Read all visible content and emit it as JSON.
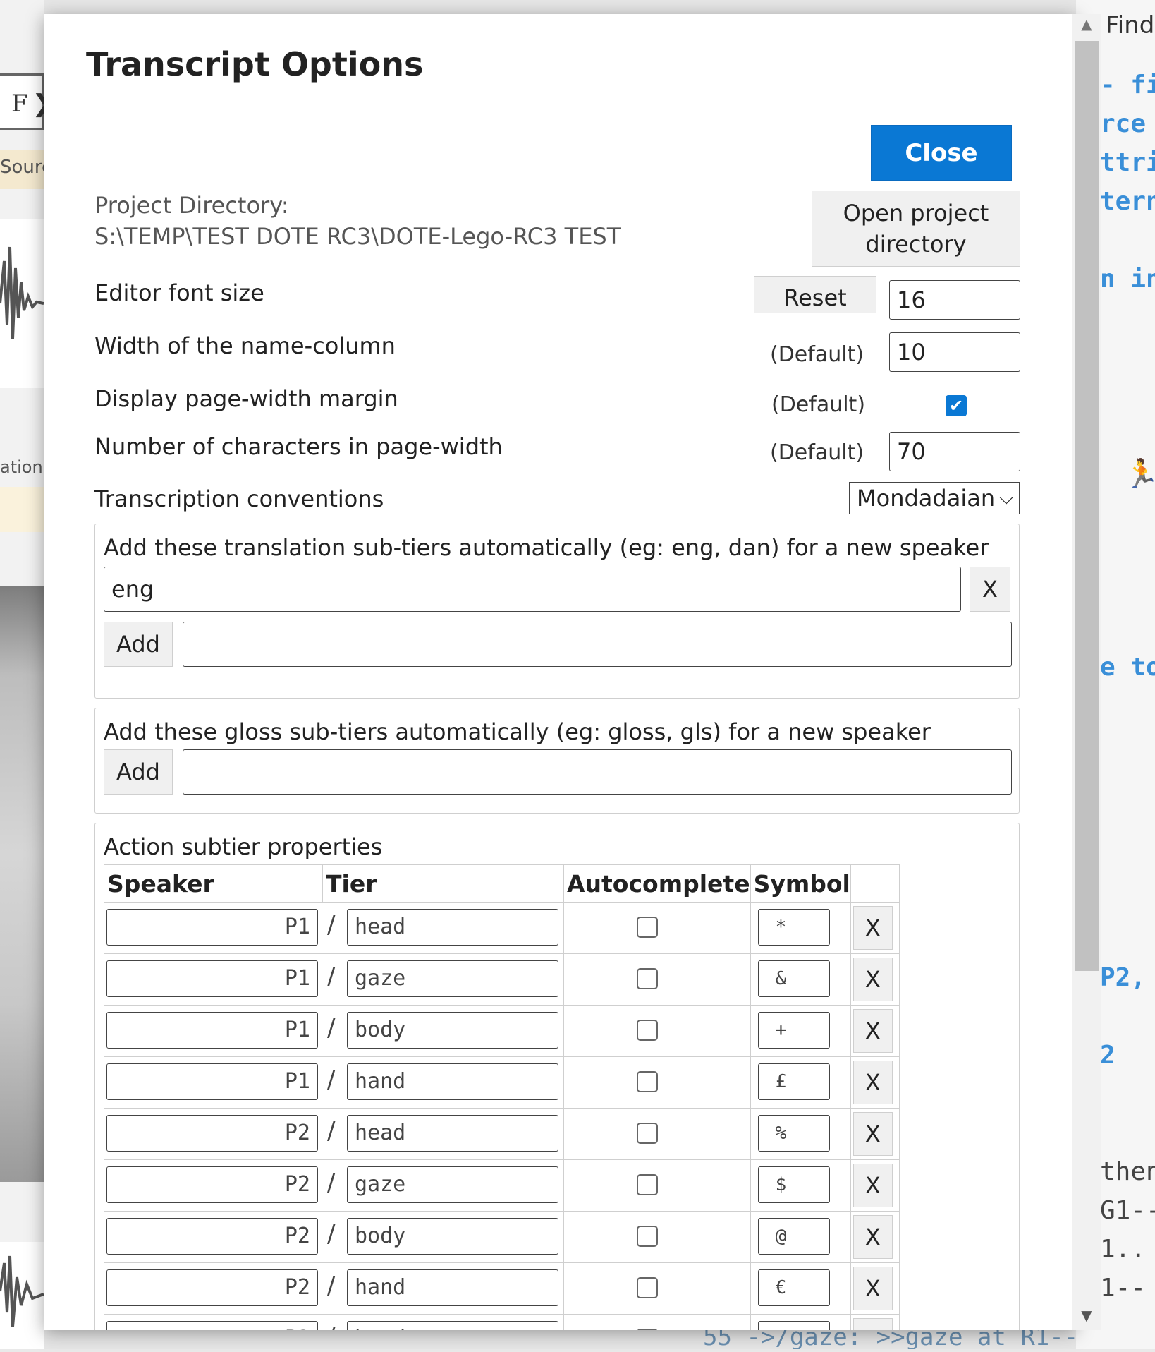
{
  "background": {
    "left_button": "F",
    "left_label_1": "Sourc",
    "left_label_2": "ation",
    "right_find": "Find",
    "right_code": [
      "- fi",
      "rce",
      "ttri",
      "tern",
      "n in",
      "e to",
      "P2,",
      "2"
    ],
    "right_plain": [
      "then",
      "G1--",
      "1..",
      "1--"
    ],
    "bottom_code": "55  ->/gaze:  >>gaze at R1--"
  },
  "modal": {
    "title": "Transcript Options",
    "close_label": "Close",
    "project_directory_label": "Project Directory:",
    "project_directory_path": "S:\\TEMP\\TEST DOTE RC3\\DOTE-Lego-RC3 TEST",
    "open_project_label": "Open project directory",
    "editor_font_size_label": "Editor font size",
    "reset_label": "Reset",
    "editor_font_size_value": "16",
    "name_column_label": "Width of the name-column",
    "default_label": "(Default)",
    "name_column_value": "10",
    "page_width_margin_label": "Display page-width margin",
    "page_width_margin_checked": true,
    "page_width_chars_label": "Number of characters in page-width",
    "page_width_chars_value": "70",
    "conventions_label": "Transcription conventions",
    "conventions_value": "Mondadaian",
    "translation_section": {
      "heading": "Add these translation sub-tiers automatically (eg: eng, dan) for a new speaker",
      "entries": [
        "eng"
      ],
      "remove_label": "X",
      "add_label": "Add",
      "new_value": ""
    },
    "gloss_section": {
      "heading": "Add these gloss sub-tiers automatically (eg: gloss, gls) for a new speaker",
      "add_label": "Add",
      "new_value": ""
    },
    "action_section": {
      "heading": "Action subtier properties",
      "columns": [
        "Speaker",
        "Tier",
        "Autocomplete",
        "Symbol",
        ""
      ],
      "remove_label": "X",
      "rows": [
        {
          "speaker": "P1",
          "tier": "head",
          "autocomplete": false,
          "symbol": "*"
        },
        {
          "speaker": "P1",
          "tier": "gaze",
          "autocomplete": false,
          "symbol": "&"
        },
        {
          "speaker": "P1",
          "tier": "body",
          "autocomplete": false,
          "symbol": "+"
        },
        {
          "speaker": "P1",
          "tier": "hand",
          "autocomplete": false,
          "symbol": "£"
        },
        {
          "speaker": "P2",
          "tier": "head",
          "autocomplete": false,
          "symbol": "%"
        },
        {
          "speaker": "P2",
          "tier": "gaze",
          "autocomplete": false,
          "symbol": "$"
        },
        {
          "speaker": "P2",
          "tier": "body",
          "autocomplete": false,
          "symbol": "@"
        },
        {
          "speaker": "P2",
          "tier": "hand",
          "autocomplete": false,
          "symbol": "€"
        },
        {
          "speaker": "P3",
          "tier": "head",
          "autocomplete": false,
          "symbol": "¥"
        }
      ]
    }
  },
  "colors": {
    "primary": "#0a78d4",
    "code_blue": "#3a8fd8"
  }
}
